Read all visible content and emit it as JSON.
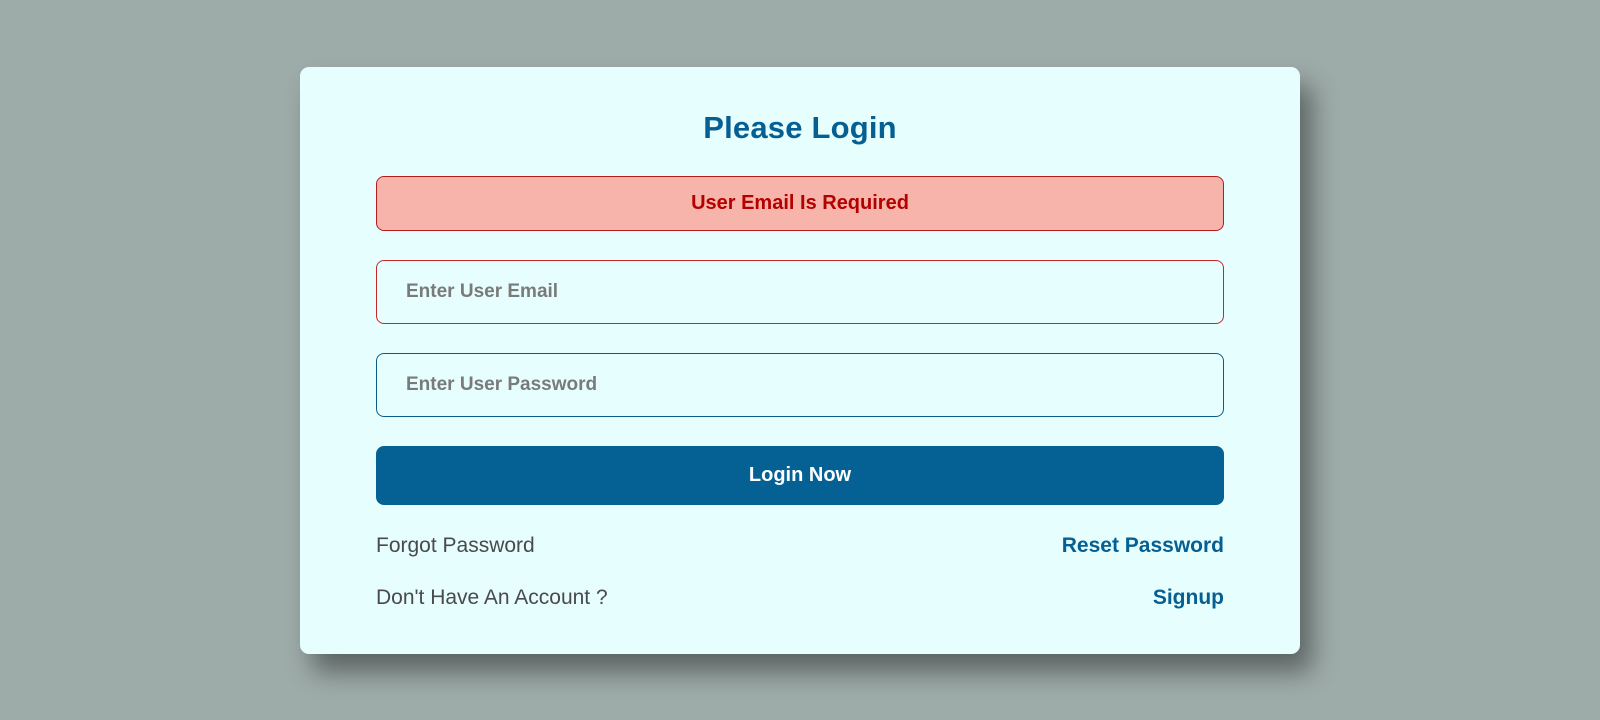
{
  "login": {
    "title": "Please Login",
    "error_message": "User Email Is Required",
    "email_placeholder": "Enter User Email",
    "email_value": "",
    "password_placeholder": "Enter User Password",
    "password_value": "",
    "submit_label": "Login Now",
    "forgot_text": "Forgot Password",
    "reset_link": "Reset Password",
    "no_account_text": "Don't Have An Account ?",
    "signup_link": "Signup"
  },
  "colors": {
    "page_background": "#9eaca9",
    "card_background": "#e6fefe",
    "accent": "#056194",
    "error_text": "#b50000",
    "error_background": "#f7b4ab"
  }
}
